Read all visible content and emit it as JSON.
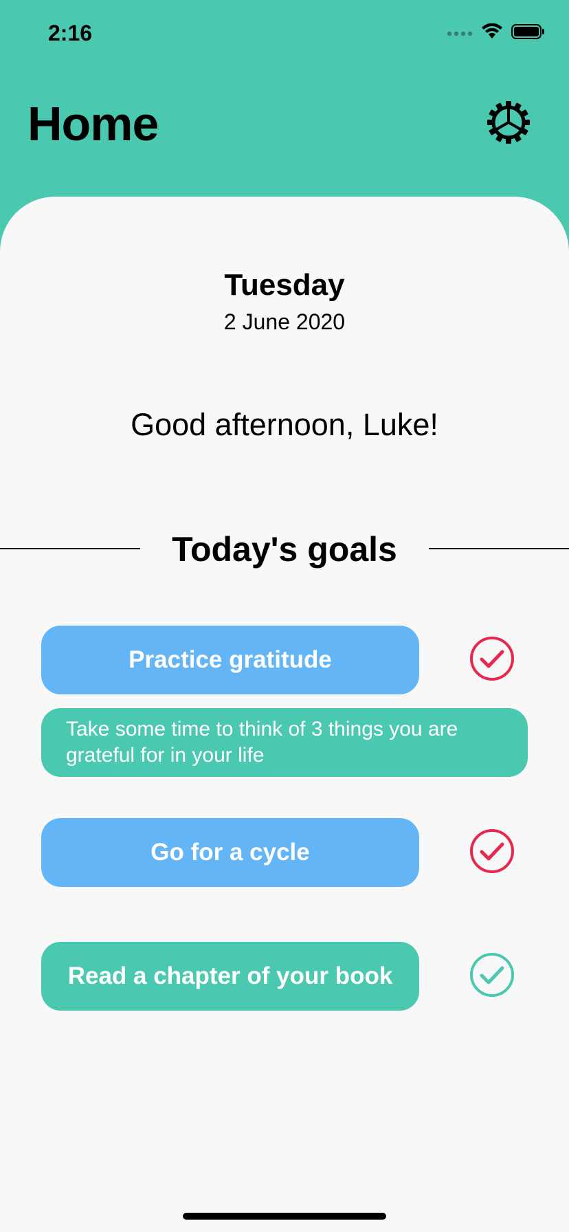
{
  "status_bar": {
    "time": "2:16"
  },
  "header": {
    "title": "Home"
  },
  "date": {
    "day": "Tuesday",
    "full": "2 June 2020"
  },
  "greeting": "Good afternoon, Luke!",
  "goals_section": {
    "title": "Today's goals"
  },
  "goals": [
    {
      "label": "Practice gratitude",
      "button_color": "#64b5f6",
      "check_color": "#e8294f",
      "description": "Take some time to think of 3 things you are grateful for in your life"
    },
    {
      "label": "Go for a cycle",
      "button_color": "#64b5f6",
      "check_color": "#e8294f"
    },
    {
      "label": "Read a chapter of your book",
      "button_color": "#4bc9b0",
      "check_color": "#4bc9b0"
    }
  ],
  "colors": {
    "accent": "#4bc9b0",
    "card_bg": "#f8f8f8",
    "goal_blue": "#64b5f6",
    "check_red": "#e8294f"
  },
  "icons": {
    "settings": "gear-icon",
    "check": "check-circle-icon",
    "wifi": "wifi-icon",
    "battery": "battery-icon",
    "signal": "signal-icon"
  }
}
